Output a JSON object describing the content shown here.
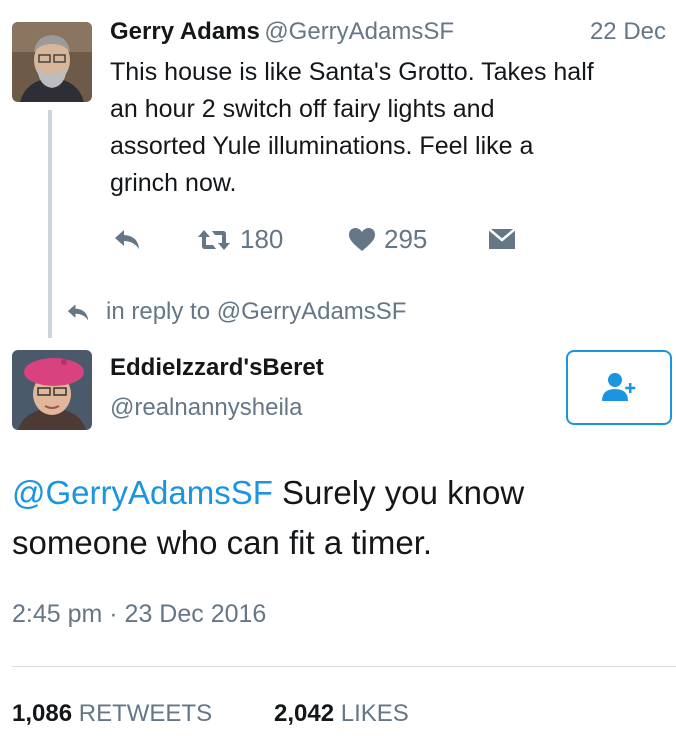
{
  "original_tweet": {
    "display_name": "Gerry Adams",
    "handle": "@GerryAdamsSF",
    "date": "22 Dec",
    "text_lines": [
      "This house is like Santa's Grotto. Takes half",
      "an hour 2 switch off fairy lights and",
      "assorted Yule illuminations. Feel like a",
      "grinch now."
    ],
    "retweet_count": "180",
    "like_count": "295"
  },
  "reply_context": {
    "text": "in reply to @GerryAdamsSF"
  },
  "reply": {
    "display_name": "EddieIzzard'sBeret",
    "handle": "@realnannysheila",
    "mention": "@GerryAdamsSF",
    "text_line1_rest": " Surely you know",
    "text_line2": "someone who can fit a timer.",
    "timestamp": "2:45 pm · 23 Dec 2016",
    "retweets_count": "1,086",
    "retweets_label": "RETWEETS",
    "likes_count": "2,042",
    "likes_label": "LIKES"
  },
  "icons": {
    "reply": "reply-icon",
    "retweet": "retweet-icon",
    "like": "heart-icon",
    "dm": "envelope-icon",
    "follow": "follow-user-icon"
  },
  "colors": {
    "link_blue": "#1b95e0",
    "muted_grey": "#657786",
    "beret_pink": "#d8437f"
  }
}
